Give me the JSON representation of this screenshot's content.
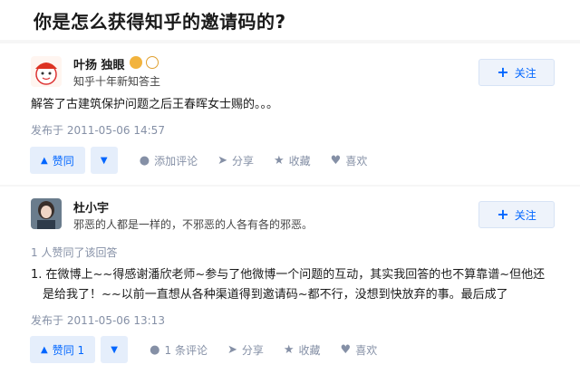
{
  "question": {
    "title": "你是怎么获得知乎的邀请码的?"
  },
  "answers": [
    {
      "author": {
        "name": "叶扬 独眼",
        "bio": "知乎十年新知答主"
      },
      "follow_label": "关注",
      "content": [
        "解答了古建筑保护问题之后王春晖女士赐的。。。"
      ],
      "published": "发布于 2011-05-06 14:57",
      "vote_up_label": "赞同",
      "actions": {
        "comment": "添加评论",
        "share": "分享",
        "collect": "收藏",
        "like": "喜欢"
      }
    },
    {
      "author": {
        "name": "杜小宇",
        "bio": "邪恶的人都是一样的，不邪恶的人各有各的邪恶。"
      },
      "follow_label": "关注",
      "voters_text": "1 人赞同了该回答",
      "content": [
        "1. 在微博上~~得感谢潘欣老师~参与了他微博一个问题的互动，其实我回答的也不算靠谱~但他还",
        "是给我了！~~以前一直想从各种渠道得到邀请码~都不行，没想到快放弃的事。最后成了"
      ],
      "published": "发布于 2011-05-06 13:13",
      "vote_up_label": "赞同 1",
      "actions": {
        "comment": "1 条评论",
        "share": "分享",
        "collect": "收藏",
        "like": "喜欢"
      }
    }
  ],
  "colors": {
    "accent": "#0066ff",
    "meta": "#8590a6",
    "vote_bg": "#e5eefb"
  }
}
